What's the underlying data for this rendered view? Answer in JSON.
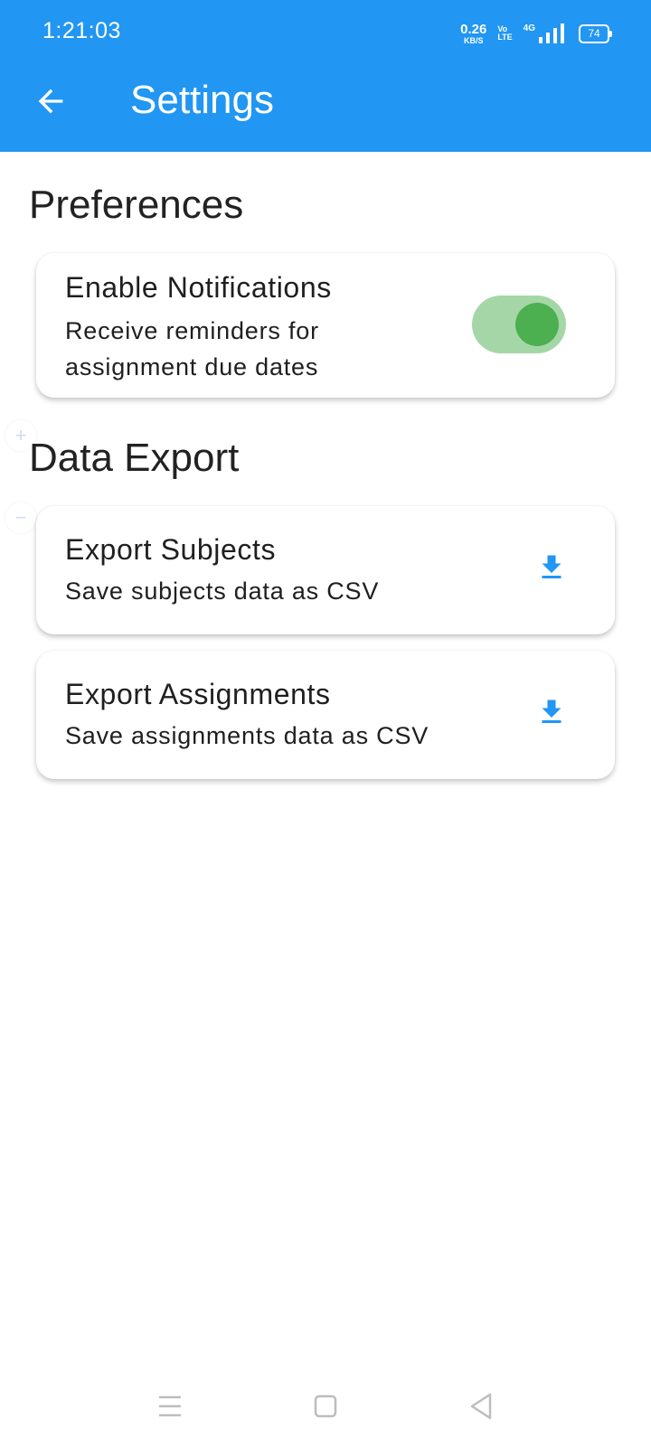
{
  "status_bar": {
    "time": "1:21:03",
    "net_speed_value": "0.26",
    "net_speed_unit": "KB/S",
    "volte_top": "Vo",
    "volte_bottom": "LTE",
    "network_type": "4G",
    "battery": "74"
  },
  "appbar": {
    "title": "Settings",
    "background": "#2196F3"
  },
  "preferences": {
    "section_title": "Preferences",
    "notifications": {
      "title": "Enable Notifications",
      "subtitle_line1": "Receive reminders for",
      "subtitle_line2": "assignment due dates",
      "enabled": true
    }
  },
  "data_export": {
    "section_title": "Data Export",
    "items": [
      {
        "title": "Export Subjects",
        "subtitle": "Save subjects data as CSV",
        "icon": "download-icon"
      },
      {
        "title": "Export Assignments",
        "subtitle": "Save assignments data as CSV",
        "icon": "download-icon"
      }
    ]
  },
  "side_controls": {
    "zoom_in": "+",
    "zoom_out": "−"
  },
  "colors": {
    "accent": "#2196F3",
    "switch_track": "#A5D6A7",
    "switch_thumb": "#4CAF50"
  }
}
